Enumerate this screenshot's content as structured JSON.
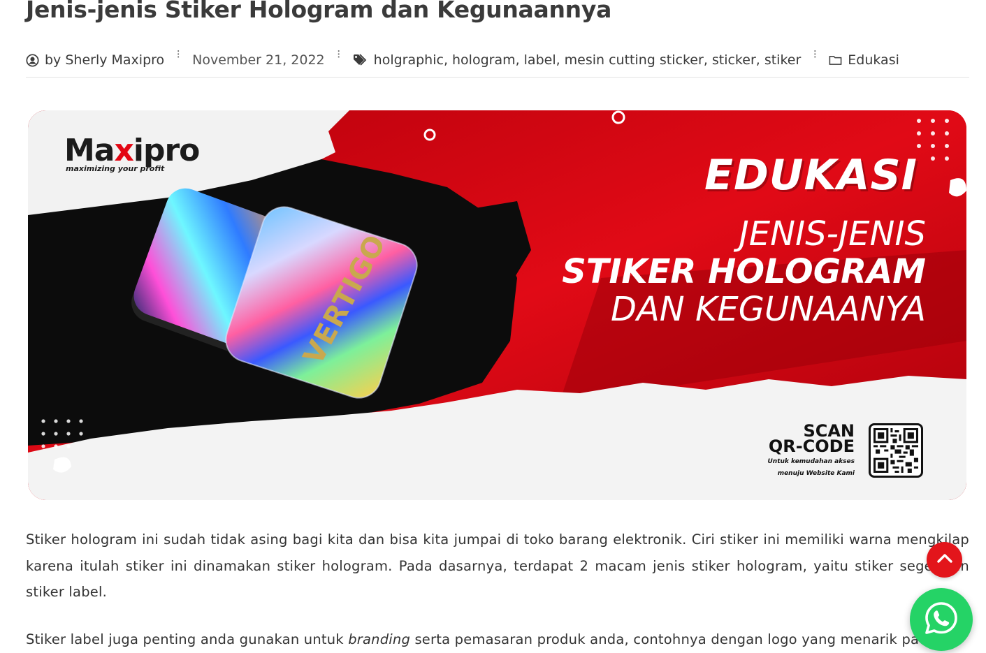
{
  "article": {
    "title": "Jenis-jenis Stiker Hologram dan Kegunaannya",
    "author": "by Sherly Maxipro",
    "date": "November 21, 2022",
    "tags": [
      "holgraphic",
      "hologram",
      "label",
      "mesin cutting sticker",
      "sticker",
      "stiker"
    ],
    "category": "Edukasi",
    "paragraph1": "Stiker hologram ini sudah tidak asing bagi kita dan bisa kita jumpai di toko barang elektronik. Ciri stiker ini memiliki warna mengkilap karena itulah stiker ini dinamakan stiker hologram. Pada dasarnya, terdapat 2 macam jenis stiker hologram, yaitu stiker segel dan stiker label.",
    "paragraph2_before": "Stiker label juga penting anda gunakan untuk ",
    "paragraph2_emphasis": "branding",
    "paragraph2_after": " serta pemasaran produk anda, contohnya dengan logo yang menarik pada"
  },
  "banner": {
    "logo_name_a": "Ma",
    "logo_name_x": "x",
    "logo_name_b": "ipro",
    "logo_tagline": "maximizing your profit",
    "badge": "EDUKASI",
    "line1": "JENIS-JENIS",
    "line2": "STIKER HOLOGRAM",
    "line3": "DAN KEGUNAANYA",
    "sticker_text": "VERTIGO",
    "scan_line1": "SCAN",
    "scan_line2": "QR-CODE",
    "scan_note1": "Untuk kemudahan akses",
    "scan_note2": "menuju Website Kami"
  },
  "colors": {
    "brand_red": "#e3151b",
    "whatsapp_green": "#25d366"
  },
  "icons": {
    "author": "user-circle-icon",
    "tags": "tags-icon",
    "category": "folder-icon",
    "scroll": "chevron-up-icon",
    "chat": "whatsapp-icon"
  }
}
